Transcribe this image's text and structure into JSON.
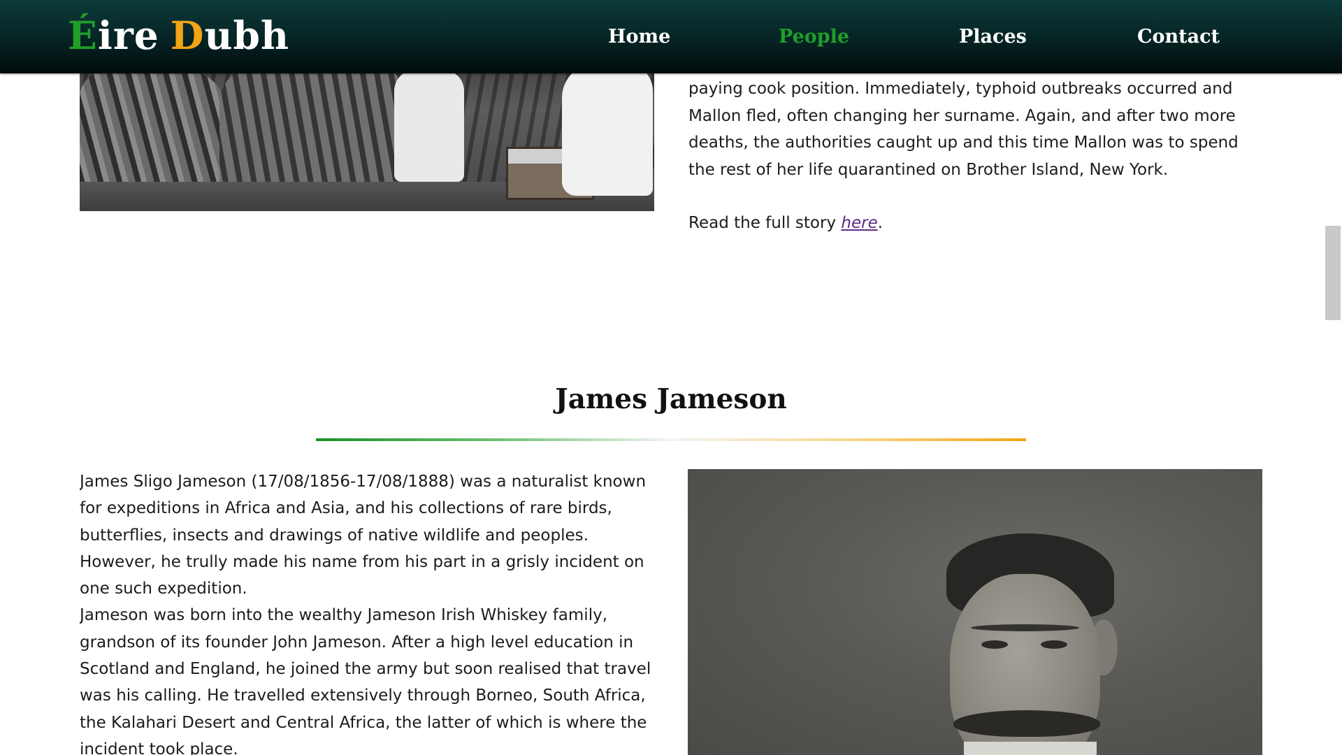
{
  "header": {
    "logo": {
      "part1_initial": "É",
      "part1_rest": "ire",
      "part2_initial": "D",
      "part2_rest": "ubh"
    },
    "nav": [
      {
        "label": "Home",
        "active": false
      },
      {
        "label": "People",
        "active": true
      },
      {
        "label": "Places",
        "active": false
      },
      {
        "label": "Contact",
        "active": false
      }
    ]
  },
  "previous_article": {
    "photo": "group-photo",
    "text": "paying cook position. Immediately, typhoid outbreaks occurred and Mallon fled, often changing her surname. Again, and after two more deaths, the authorities caught up and this time Mallon was to spend the rest of her life quarantined on Brother Island, New York.",
    "read_more_prefix": "Read the full story ",
    "read_more_link": "here",
    "read_more_suffix": "."
  },
  "section": {
    "title": "James Jameson",
    "paragraphs": [
      "James Sligo Jameson (17/08/1856-17/08/1888) was a naturalist known for expeditions in Africa and Asia, and his collections of rare birds, butterflies, insects and drawings of native wildlife and peoples. However, he trully made his name from his part in a grisly incident on one such expedition.",
      "Jameson was born into the wealthy Jameson Irish Whiskey family, grandson of its founder John Jameson. After a high level education in Scotland and England, he joined the army but soon realised that travel was his calling. He travelled extensively through Borneo, South Africa, the Kalahari Desert and Central Africa, the latter of which is where the incident took place."
    ],
    "photo": "portrait-photo"
  },
  "colors": {
    "brand_green": "#1f9e2a",
    "brand_orange": "#f2a516",
    "header_dark": "#062323",
    "link_purple": "#5a2d86"
  }
}
